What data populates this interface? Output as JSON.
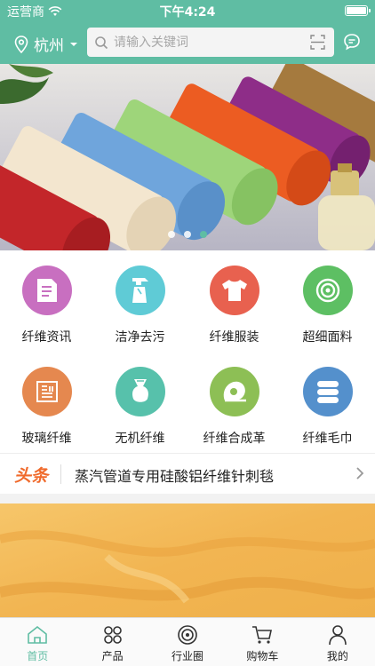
{
  "status_bar": {
    "carrier": "运营商",
    "time": "下午4:24"
  },
  "header": {
    "city": "杭州",
    "search_placeholder": "请输入关键词"
  },
  "banner": {
    "dot_count": 3,
    "active_dot": 3
  },
  "categories": [
    {
      "label": "纤维资讯",
      "color": "#c86fc0",
      "icon": "document-icon"
    },
    {
      "label": "洁净去污",
      "color": "#5fcbd6",
      "icon": "spray-bottle-icon"
    },
    {
      "label": "纤维服装",
      "color": "#e8614f",
      "icon": "tshirt-icon"
    },
    {
      "label": "超细面料",
      "color": "#5dbf63",
      "icon": "fabric-roll-icon"
    },
    {
      "label": "玻璃纤维",
      "color": "#e5884f",
      "icon": "glass-fiber-icon"
    },
    {
      "label": "无机纤维",
      "color": "#57c1ab",
      "icon": "vase-icon"
    },
    {
      "label": "纤维合成革",
      "color": "#8dbf55",
      "icon": "leather-roll-icon"
    },
    {
      "label": "纤维毛巾",
      "color": "#5490cc",
      "icon": "towel-stack-icon"
    }
  ],
  "news": {
    "tag": "头条",
    "headline": "蒸汽管道专用硅酸铝纤维针刺毯"
  },
  "tabbar": [
    {
      "label": "首页",
      "icon": "home-icon",
      "active": true
    },
    {
      "label": "产品",
      "icon": "products-icon",
      "active": false
    },
    {
      "label": "行业圈",
      "icon": "industry-circle-icon",
      "active": false
    },
    {
      "label": "购物车",
      "icon": "cart-icon",
      "active": false
    },
    {
      "label": "我的",
      "icon": "profile-icon",
      "active": false
    }
  ],
  "colors": {
    "brand": "#5fbda3",
    "news_tag": "#f06a2b"
  }
}
